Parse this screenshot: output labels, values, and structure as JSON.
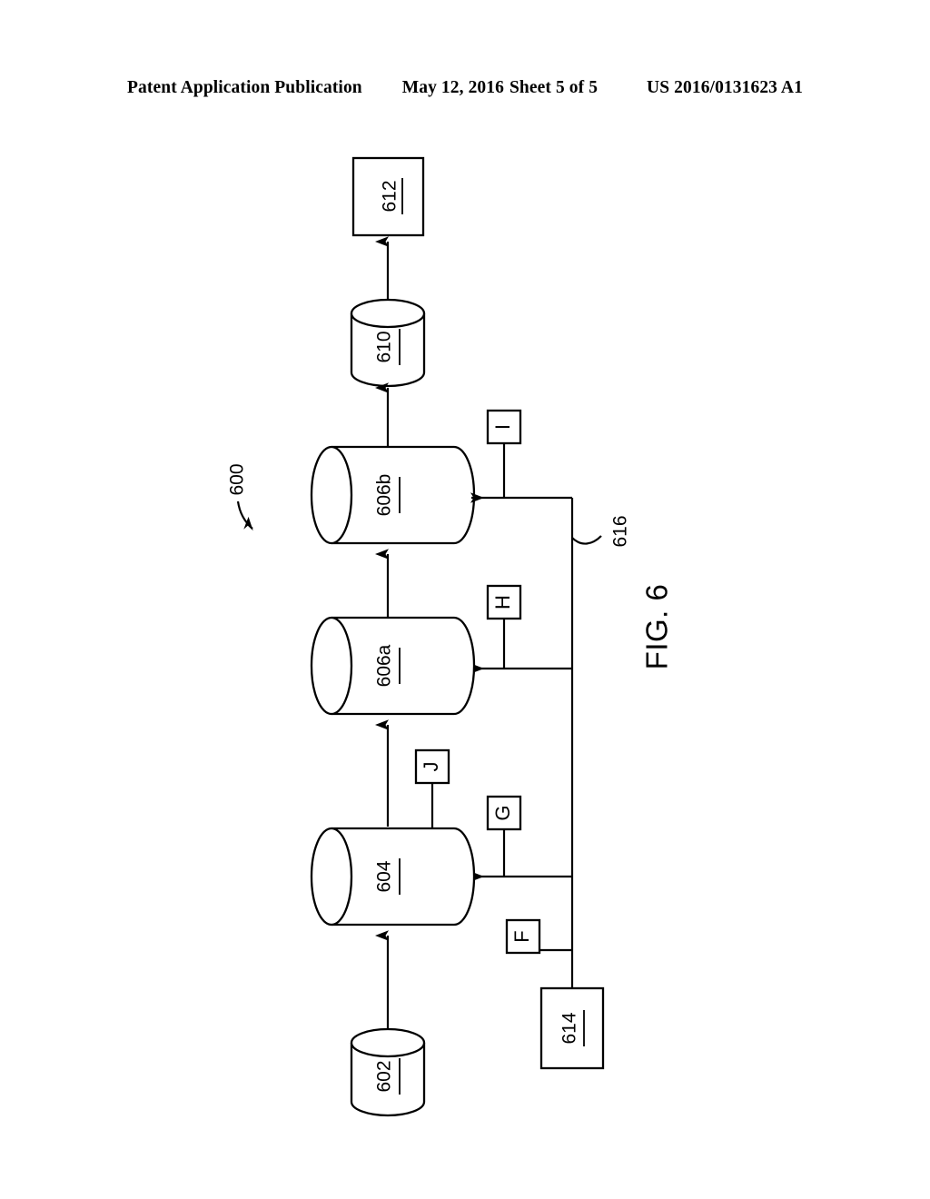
{
  "header": {
    "publication": "Patent Application Publication",
    "date": "May 12, 2016",
    "sheet": "Sheet 5 of 5",
    "patent_number": "US 2016/0131623 A1"
  },
  "figure": {
    "caption": "FIG. 6",
    "system_ref": "600",
    "manifold_ref": "616",
    "nodes": {
      "n602": "602",
      "n604": "604",
      "n606a": "606a",
      "n606b": "606b",
      "n610": "610",
      "n612": "612",
      "n614": "614"
    },
    "ports": {
      "f": "F",
      "g": "G",
      "h": "H",
      "i": "I",
      "j": "J"
    }
  }
}
